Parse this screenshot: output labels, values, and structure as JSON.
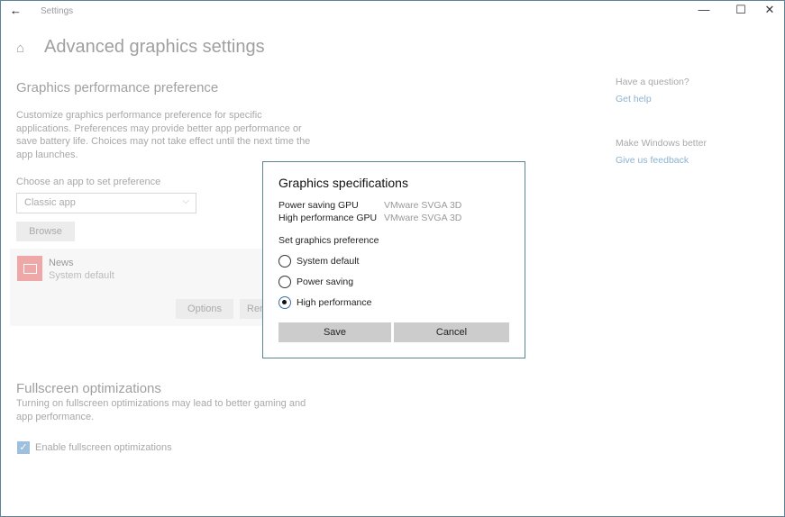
{
  "window": {
    "title": "Settings",
    "back_icon": "←",
    "minimize_icon": "—",
    "maximize_icon": "☐",
    "close_icon": "✕"
  },
  "page": {
    "home_icon": "⌂",
    "title": "Advanced graphics settings"
  },
  "graphics_pref": {
    "heading": "Graphics performance preference",
    "description": "Customize graphics performance preference for specific applications. Preferences may provide better app performance or save battery life. Choices may not take effect until the next time the app launches.",
    "choose_label": "Choose an app to set preference",
    "dropdown_value": "Classic app",
    "chevron": "⌵",
    "browse_label": "Browse",
    "apps": [
      {
        "name": "News",
        "preference": "System default",
        "options_label": "Options",
        "remove_label": "Remove"
      }
    ]
  },
  "fullscreen": {
    "heading": "Fullscreen optimizations",
    "description": "Turning on fullscreen optimizations may lead to better gaming and app performance.",
    "checkbox_label": "Enable fullscreen optimizations",
    "checked": true,
    "check_glyph": "✓"
  },
  "sidebar": {
    "question_heading": "Have a question?",
    "get_help": "Get help",
    "better_heading": "Make Windows better",
    "feedback": "Give us feedback"
  },
  "dialog": {
    "title": "Graphics specifications",
    "power_saving_gpu_label": "Power saving GPU",
    "power_saving_gpu_value": "VMware SVGA 3D",
    "high_perf_gpu_label": "High performance GPU",
    "high_perf_gpu_value": "VMware SVGA 3D",
    "set_pref_label": "Set graphics preference",
    "options": [
      "System default",
      "Power saving",
      "High performance"
    ],
    "selected": "High performance",
    "save_label": "Save",
    "cancel_label": "Cancel"
  }
}
